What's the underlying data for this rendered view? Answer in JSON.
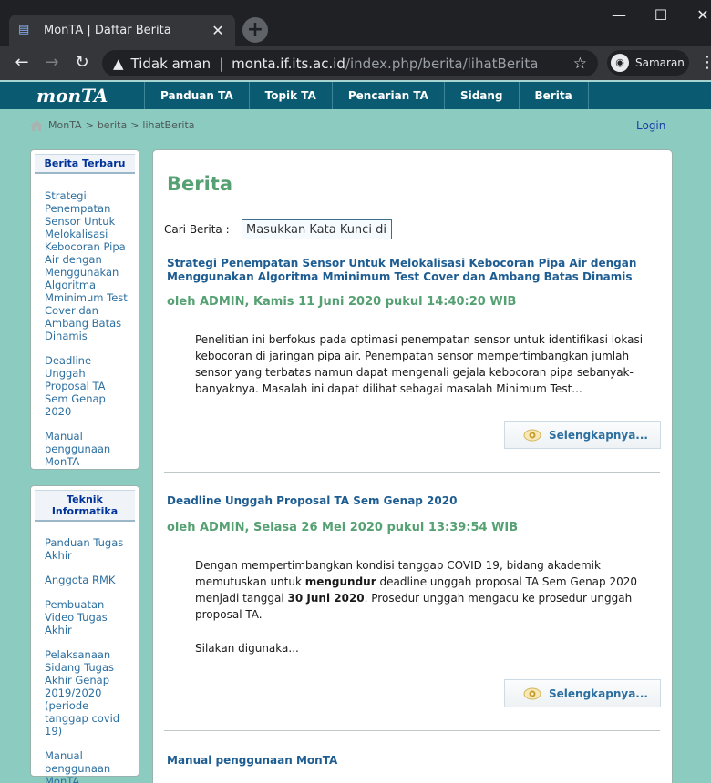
{
  "browser": {
    "tab_title": "MonTA | Daftar Berita",
    "tab_close": "✕",
    "new_tab": "+",
    "win_min": "—",
    "win_max": "☐",
    "win_close": "✕",
    "back": "←",
    "forward": "→",
    "reload": "↻",
    "security_label": "Tidak aman",
    "url_host": "monta.if.its.ac.id",
    "url_path": "/index.php/berita/lihatBerita",
    "profile_label": "Samaran",
    "star": "☆",
    "kebab": "⋮"
  },
  "site": {
    "logo": "monTA",
    "menu": [
      "Panduan TA",
      "Topik TA",
      "Pencarian TA",
      "Sidang",
      "Berita"
    ],
    "login": "Login"
  },
  "breadcrumb": {
    "home": "MonTA",
    "sep": ">",
    "items": [
      "berita",
      "lihatBerita"
    ]
  },
  "sidebar": {
    "latest": {
      "title": "Berita Terbaru",
      "items": [
        "Strategi Penempatan Sensor Untuk Melokalisasi Kebocoran Pipa Air dengan Menggunakan Algoritma Mminimum Test Cover dan Ambang Batas Dinamis",
        "Deadline Unggah Proposal TA Sem Genap 2020",
        "Manual penggunaan MonTA"
      ]
    },
    "informatics": {
      "title": "Teknik Informatika",
      "items": [
        "Panduan Tugas Akhir",
        "Anggota RMK",
        "Pembuatan Video Tugas Akhir",
        "Pelaksanaan Sidang Tugas Akhir Genap 2019/2020 (periode tanggap covid 19)",
        "Manual penggunaan MonTA"
      ]
    }
  },
  "main": {
    "title": "Berita",
    "search_label": "Cari Berita :",
    "search_placeholder": "Masukkan Kata Kunci di sini",
    "more_label": "Selengkapnya...",
    "articles": [
      {
        "title": "Strategi Penempatan Sensor Untuk Melokalisasi Kebocoran Pipa Air dengan Menggunakan Algoritma Mminimum Test Cover dan Ambang Batas Dinamis",
        "meta": "oleh ADMIN, Kamis 11 Juni 2020 pukul 14:40:20 WIB",
        "body": "Penelitian ini berfokus pada optimasi penempatan sensor untuk identifikasi lokasi kebocoran di jaringan pipa air. Penempatan sensor mempertimbangkan jumlah sensor yang terbatas namun dapat mengenali gejala kebocoran pipa sebanyak-banyaknya. Masalah ini dapat dilihat sebagai masalah Minimum Test..."
      },
      {
        "title": "Deadline Unggah Proposal TA Sem Genap 2020",
        "meta": "oleh ADMIN, Selasa 26 Mei 2020 pukul 13:39:54 WIB",
        "body_1": "Dengan mempertimbangkan kondisi tanggap COVID 19, bidang akademik memutuskan untuk ",
        "body_bold_1": "mengundur",
        "body_2": " deadline unggah proposal TA Sem Genap 2020 menjadi tanggal ",
        "body_bold_2": "30 Juni 2020",
        "body_3": ". Prosedur unggah mengacu ke prosedur unggah proposal TA.",
        "body_more": "Silakan digunaka..."
      },
      {
        "title": "Manual penggunaan MonTA"
      }
    ]
  }
}
